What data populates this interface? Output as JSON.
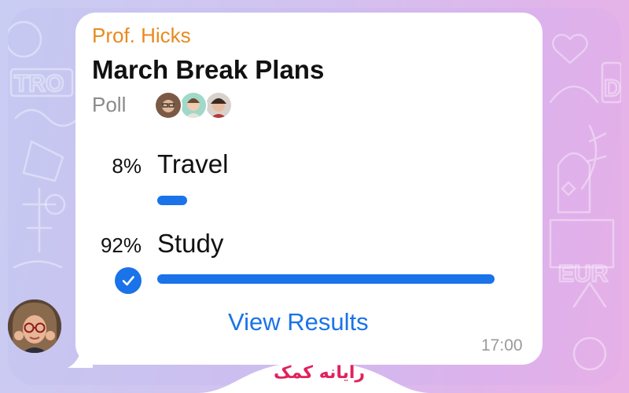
{
  "message": {
    "sender": "Prof. Hicks",
    "time": "17:00"
  },
  "poll": {
    "question": "March Break Plans",
    "type_label": "Poll",
    "voters": [
      "voter-avatar-1",
      "voter-avatar-2",
      "voter-avatar-3"
    ],
    "options": [
      {
        "label": "Travel",
        "percent_label": "8%",
        "percent": 8,
        "selected": false
      },
      {
        "label": "Study",
        "percent_label": "92%",
        "percent": 92,
        "selected": true
      }
    ],
    "view_results_label": "View Results"
  },
  "watermark": {
    "text": "رایانه کمک"
  },
  "colors": {
    "sender": "#e88a1f",
    "accent": "#1a73e8",
    "watermark": "#e0225c"
  }
}
